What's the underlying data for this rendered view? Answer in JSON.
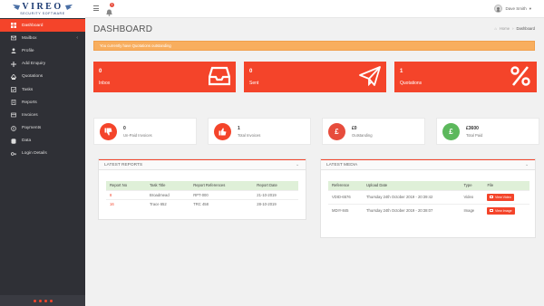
{
  "brand": {
    "name": "VIREO",
    "tagline": "SECURITY SOFTWARE"
  },
  "header": {
    "notification_count": "1",
    "user_name": "Dave Smith",
    "user_caret": "▾"
  },
  "sidebar": {
    "items": [
      {
        "label": "Dashboard",
        "icon": "dashboard-icon",
        "active": true
      },
      {
        "label": "Mailbox",
        "icon": "mailbox-icon",
        "caret": "‹"
      },
      {
        "label": "Profile",
        "icon": "user-icon"
      },
      {
        "label": "Add Enquiry",
        "icon": "plus-icon"
      },
      {
        "label": "Quotations",
        "icon": "quotations-icon"
      },
      {
        "label": "Tasks",
        "icon": "tasks-icon"
      },
      {
        "label": "Reports",
        "icon": "reports-icon"
      },
      {
        "label": "Invoices",
        "icon": "invoices-icon"
      },
      {
        "label": "Payments",
        "icon": "payments-icon"
      },
      {
        "label": "Data",
        "icon": "data-icon"
      },
      {
        "label": "Login Details",
        "icon": "key-icon"
      }
    ]
  },
  "page": {
    "title": "DASHBOARD",
    "breadcrumb": {
      "home": "Home",
      "sep": "›",
      "current": "Dashboard"
    }
  },
  "alert": {
    "text": "You currently have Quotations outstanding"
  },
  "big_cards": [
    {
      "value": "0",
      "label": "Inbox",
      "icon": "inbox-icon"
    },
    {
      "value": "0",
      "label": "Sent",
      "icon": "paper-plane-icon"
    },
    {
      "value": "1",
      "label": "Quotations",
      "icon": "percent-icon"
    }
  ],
  "small_cards": [
    {
      "value": "0",
      "label": "Un-Paid Invoices",
      "icon": "thumbs-down-icon",
      "color": "#f4442a"
    },
    {
      "value": "1",
      "label": "Total Invoices",
      "icon": "thumbs-up-icon",
      "color": "#f4442a"
    },
    {
      "value": "£0",
      "label": "Outstanding",
      "icon": "pound-icon",
      "color": "#e74c3c",
      "glyph": "£"
    },
    {
      "value": "£3600",
      "label": "Total Paid",
      "icon": "pound-icon",
      "color": "#5cb85c",
      "glyph": "£"
    }
  ],
  "reports": {
    "title": "LATEST REPORTS",
    "columns": [
      "Report No",
      "Task Title",
      "Report References",
      "Report Date"
    ],
    "rows": [
      [
        "8",
        "Broadmead",
        "RPT-000",
        "21-10-2019"
      ],
      [
        "16",
        "Trace 652",
        "TRC 458",
        "28-10-2019"
      ]
    ]
  },
  "media": {
    "title": "LATEST MEDIA",
    "columns": [
      "Reference",
      "Upload Date",
      "Type",
      "File"
    ],
    "rows": [
      {
        "ref": "VDID-6576",
        "date": "Thursday 24th October 2019 - 20:39:42",
        "type": "Video",
        "button": "View Video"
      },
      {
        "ref": "MDIY-845",
        "date": "Thursday 24th October 2019 - 20:38:07",
        "type": "Image",
        "button": "View Image"
      }
    ]
  },
  "colors": {
    "accent": "#f4442a",
    "sidebar": "#2f3036",
    "alert": "#f8ae5e",
    "success": "#5cb85c",
    "table_head": "#dff0d8"
  }
}
